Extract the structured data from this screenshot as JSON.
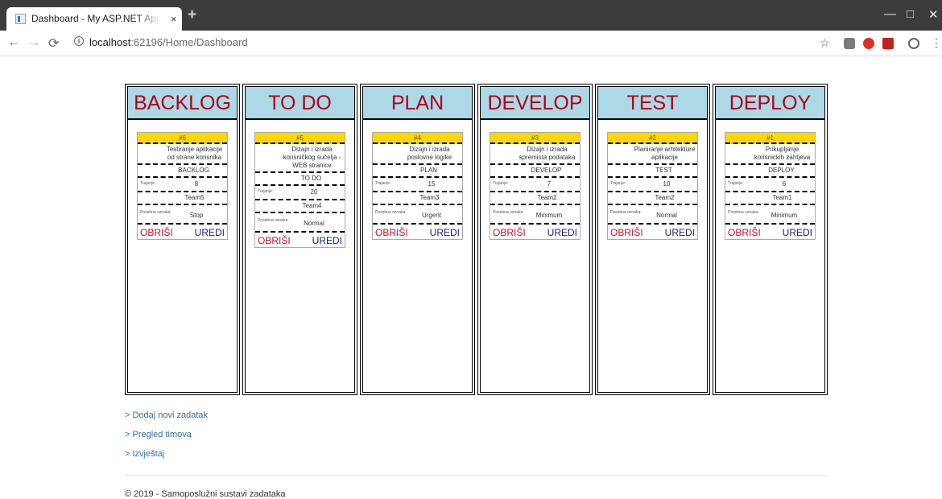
{
  "browser": {
    "tab_title": "Dashboard - My ASP.NET Applica",
    "tab_close": "×",
    "new_tab": "+",
    "url_host": "localhost",
    "url_path": ":62196/Home/Dashboard",
    "window_controls": [
      "—",
      "□",
      "✕"
    ]
  },
  "columns": [
    {
      "title": "BACKLOG"
    },
    {
      "title": "TO DO"
    },
    {
      "title": "PLAN"
    },
    {
      "title": "DEVELOP"
    },
    {
      "title": "TEST"
    },
    {
      "title": "DEPLOY"
    }
  ],
  "cards": [
    {
      "num": "#6",
      "desc": "Testiranje aplikacije od strane korisnika",
      "stage": "BACKLOG",
      "trajanje_label": "Trajanje:",
      "trajanje": "8",
      "team": "Team5",
      "posebna_label": "Posebna oznaka:",
      "posebna": "Stop",
      "delete": "OBRIŠI",
      "edit": "UREDI"
    },
    {
      "num": "#5",
      "desc": "Dizajn i izrada korisničkog sučelja - WEB stranice",
      "stage": "TO DO",
      "trajanje_label": "Trajanje:",
      "trajanje": "20",
      "team": "Team4",
      "posebna_label": "Posebna oznaka:",
      "posebna": "Normal",
      "delete": "OBRIŠI",
      "edit": "UREDI"
    },
    {
      "num": "#4",
      "desc": "Dizajn i izrada poslovne logike",
      "stage": "PLAN",
      "trajanje_label": "Trajanje:",
      "trajanje": "15",
      "team": "Team3",
      "posebna_label": "Posebna oznaka:",
      "posebna": "Urgent",
      "delete": "OBRIŠI",
      "edit": "UREDI"
    },
    {
      "num": "#3",
      "desc": "Dizajn i izrada spremista podataka",
      "stage": "DEVELOP",
      "trajanje_label": "Trajanje:",
      "trajanje": "7",
      "team": "Team2",
      "posebna_label": "Posebna oznaka:",
      "posebna": "Minimum",
      "delete": "OBRIŠI",
      "edit": "UREDI"
    },
    {
      "num": "#2",
      "desc": "Planiranje arhitekture aplikacije",
      "stage": "TEST",
      "trajanje_label": "Trajanje:",
      "trajanje": "10",
      "team": "Team2",
      "posebna_label": "Posebna oznaka:",
      "posebna": "Normal",
      "delete": "OBRIŠI",
      "edit": "UREDI"
    },
    {
      "num": "#1",
      "desc": "Prikupljanje korisnickih zahtjeva",
      "stage": "DEPLOY",
      "trajanje_label": "Trajanje:",
      "trajanje": "6",
      "team": "Team1",
      "posebna_label": "Posebna oznaka:",
      "posebna": "Minimum",
      "delete": "OBRIŠI",
      "edit": "UREDI"
    }
  ],
  "links": [
    "> Dodaj novi zadatak",
    "> Pregled timova",
    "> Izvještaj"
  ],
  "footer": "© 2019 - Samoposlužni sustavi zadataka",
  "colors": {
    "header_bg": "#add8e6",
    "header_text": "#b0001a",
    "card_num_bg": "#ffd700",
    "delete": "#c8102e",
    "edit": "#1a237e",
    "link": "#2f6fa3"
  }
}
